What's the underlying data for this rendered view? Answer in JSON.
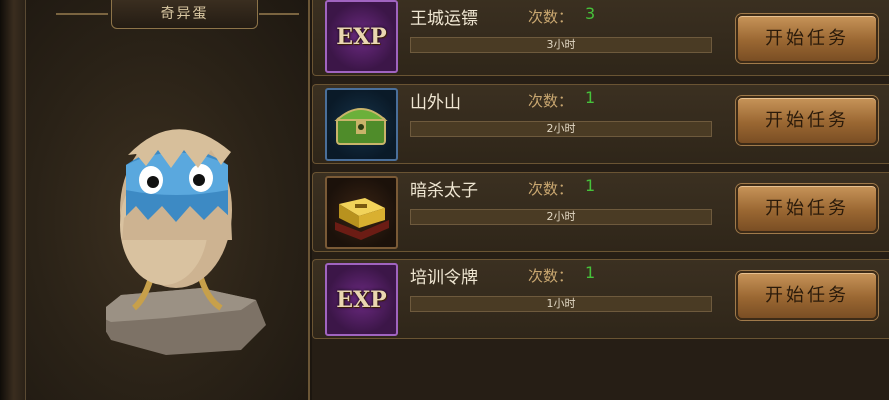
{
  "pet_panel": {
    "title": "奇异蛋"
  },
  "count_label": "次数：",
  "tasks": [
    {
      "name": "王城运镖",
      "count": "3",
      "duration": "3小时",
      "icon": "exp-icon",
      "button": "开始任务"
    },
    {
      "name": "山外山",
      "count": "1",
      "duration": "2小时",
      "icon": "green-treasure-chest-icon",
      "button": "开始任务"
    },
    {
      "name": "暗杀太子",
      "count": "1",
      "duration": "2小时",
      "icon": "gold-box-icon",
      "button": "开始任务"
    },
    {
      "name": "培训令牌",
      "count": "1",
      "duration": "1小时",
      "icon": "exp-icon",
      "button": "开始任务"
    }
  ],
  "icon_text": {
    "exp": "EXP"
  },
  "colors": {
    "count_value": "#46c23a",
    "button": "#9a6732",
    "panel_border": "#6a5433"
  }
}
